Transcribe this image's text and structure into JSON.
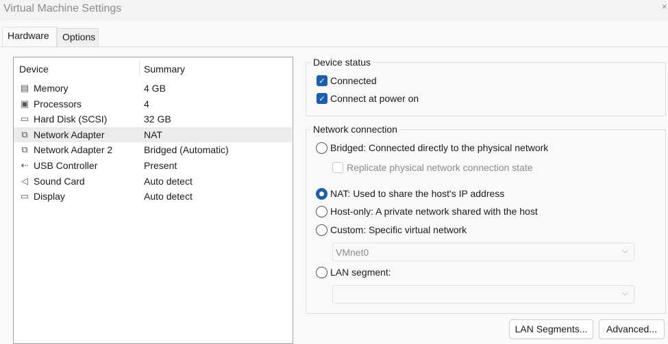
{
  "window": {
    "title": "Virtual Machine Settings",
    "close_icon": "×"
  },
  "tabs": [
    {
      "label": "Hardware",
      "active": true
    },
    {
      "label": "Options",
      "active": false
    }
  ],
  "device_list": {
    "headers": {
      "device": "Device",
      "summary": "Summary"
    },
    "rows": [
      {
        "icon": "memory-icon",
        "glyph": "▤",
        "device": "Memory",
        "summary": "4 GB"
      },
      {
        "icon": "processor-icon",
        "glyph": "▣",
        "device": "Processors",
        "summary": "4"
      },
      {
        "icon": "hard-disk-icon",
        "glyph": "▭",
        "device": "Hard Disk (SCSI)",
        "summary": "32 GB"
      },
      {
        "icon": "network-adapter-icon",
        "glyph": "⧉",
        "device": "Network Adapter",
        "summary": "NAT",
        "selected": true
      },
      {
        "icon": "network-adapter-icon",
        "glyph": "⧉",
        "device": "Network Adapter 2",
        "summary": "Bridged (Automatic)"
      },
      {
        "icon": "usb-icon",
        "glyph": "⇠",
        "device": "USB Controller",
        "summary": "Present"
      },
      {
        "icon": "speaker-icon",
        "glyph": "◁",
        "device": "Sound Card",
        "summary": "Auto detect"
      },
      {
        "icon": "display-icon",
        "glyph": "▭",
        "device": "Display",
        "summary": "Auto detect"
      }
    ]
  },
  "device_status": {
    "legend": "Device status",
    "connected": "Connected",
    "connect_at_power_on": "Connect at power on"
  },
  "network_connection": {
    "legend": "Network connection",
    "bridged": "Bridged: Connected directly to the physical network",
    "replicate": "Replicate physical network connection state",
    "nat": "NAT: Used to share the host's IP address",
    "host_only": "Host-only: A private network shared with the host",
    "custom": "Custom: Specific virtual network",
    "custom_value": "VMnet0",
    "lan_segment": "LAN segment:",
    "lan_segment_value": "",
    "selected": "nat"
  },
  "buttons": {
    "lan_segments": "LAN Segments...",
    "advanced": "Advanced..."
  },
  "colors": {
    "accent": "#1a5fb4"
  }
}
